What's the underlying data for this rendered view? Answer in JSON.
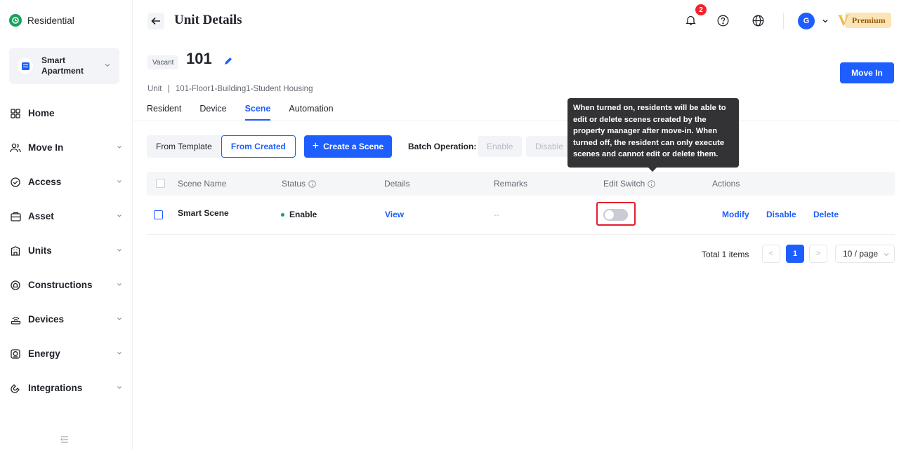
{
  "brand": {
    "name": "Residential"
  },
  "project": {
    "name": "Smart Apartment"
  },
  "nav": [
    {
      "label": "Home",
      "icon": "grid-icon",
      "chevron": false
    },
    {
      "label": "Move In",
      "icon": "users-icon",
      "chevron": true
    },
    {
      "label": "Access",
      "icon": "shield-check-icon",
      "chevron": true
    },
    {
      "label": "Asset",
      "icon": "box-icon",
      "chevron": true
    },
    {
      "label": "Units",
      "icon": "building-icon",
      "chevron": true
    },
    {
      "label": "Constructions",
      "icon": "hardhat-icon",
      "chevron": true
    },
    {
      "label": "Devices",
      "icon": "router-icon",
      "chevron": true
    },
    {
      "label": "Energy",
      "icon": "meter-icon",
      "chevron": true
    },
    {
      "label": "Integrations",
      "icon": "plug-icon",
      "chevron": true
    }
  ],
  "header": {
    "title": "Unit Details",
    "notification_count": "2",
    "avatar_letter": "G",
    "premium_mark": "V",
    "premium_label": "Premium"
  },
  "unit": {
    "status_tag": "Vacant",
    "number": "101",
    "move_in_label": "Move In",
    "path_prefix": "Unit",
    "path_sep": "|",
    "path": "101-Floor1-Building1-Student Housing"
  },
  "tabs": [
    {
      "label": "Resident",
      "active": false
    },
    {
      "label": "Device",
      "active": false
    },
    {
      "label": "Scene",
      "active": true
    },
    {
      "label": "Automation",
      "active": false
    }
  ],
  "toolbar": {
    "from_template": "From Template",
    "from_created": "From Created",
    "create_scene": "Create a Scene",
    "create_plus": "+",
    "batch_label": "Batch Operation:",
    "enable": "Enable",
    "disable": "Disable"
  },
  "table": {
    "columns": {
      "scene_name": "Scene Name",
      "status": "Status",
      "details": "Details",
      "remarks": "Remarks",
      "edit_switch": "Edit Switch",
      "actions": "Actions"
    },
    "rows": [
      {
        "scene_name": "Smart Scene",
        "status": "Enable",
        "details": "View",
        "remarks": "--",
        "edit_switch_on": false,
        "actions": {
          "modify": "Modify",
          "disable": "Disable",
          "delete": "Delete"
        }
      }
    ]
  },
  "pagination": {
    "total": "Total 1 items",
    "prev": "<",
    "current": "1",
    "next": ">",
    "page_size": "10 / page"
  },
  "tooltip": {
    "text": "When turned on, residents will be able to edit or delete scenes created by the property manager after move-in. When turned off, the resident can only execute scenes and cannot edit or delete them."
  },
  "colors": {
    "accent": "#1e5eff",
    "brand": "#16a35a",
    "danger": "#e11d2e",
    "premium": "#f2b84b"
  }
}
